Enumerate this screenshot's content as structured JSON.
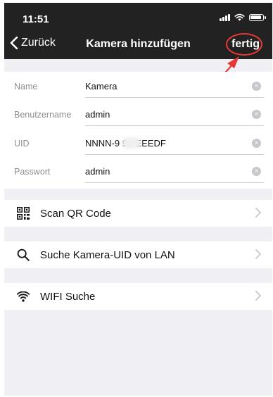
{
  "status": {
    "time": "11:51"
  },
  "nav": {
    "back_label": "Zurück",
    "title": "Kamera hinzufügen",
    "done_label": "fertig"
  },
  "form": {
    "fields": [
      {
        "label": "Name",
        "value": "Kamera"
      },
      {
        "label": "Benutzername",
        "value": "admin"
      },
      {
        "label": "UID",
        "value": "NNNN-9 99-EEEDF"
      },
      {
        "label": "Passwort",
        "value": "admin"
      }
    ]
  },
  "menu": {
    "items": [
      {
        "label": "Scan QR Code",
        "icon": "qr-code-icon"
      },
      {
        "label": "Suche Kamera-UID von LAN",
        "icon": "search-icon"
      },
      {
        "label": "WIFI Suche",
        "icon": "wifi-icon"
      }
    ]
  },
  "colors": {
    "topbar": "#222222",
    "background": "#efeff4",
    "annotation": "#e53935"
  }
}
